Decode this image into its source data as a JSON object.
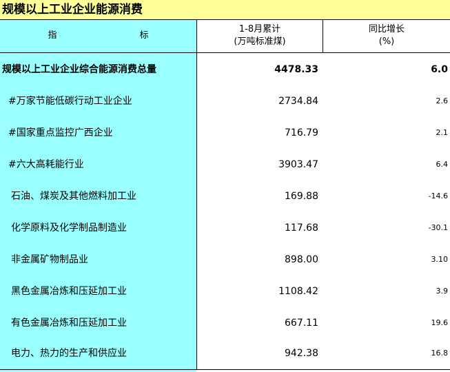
{
  "title": "规模以上工业企业能源消费",
  "header": {
    "indicator_left": "指",
    "indicator_right": "标",
    "cumulative_line1": "1-8月累计",
    "cumulative_line2": "(万吨标准煤)",
    "yoy_line1": "同比增长",
    "yoy_line2": "(%)"
  },
  "rows": [
    {
      "name": "规模以上工业企业综合能源消费总量",
      "value": "4478.33",
      "yoy": "6.0"
    },
    {
      "name": "#万家节能低碳行动工业企业",
      "value": "2734.84",
      "yoy": "2.6"
    },
    {
      "name": "#国家重点监控广西企业",
      "value": "716.79",
      "yoy": "2.1"
    },
    {
      "name": "#六大高耗能行业",
      "value": "3903.47",
      "yoy": "6.4"
    },
    {
      "name": "石油、煤炭及其他燃料加工业",
      "value": "169.88",
      "yoy": "-14.6"
    },
    {
      "name": "化学原料及化学制品制造业",
      "value": "117.68",
      "yoy": "-30.1"
    },
    {
      "name": "非金属矿物制品业",
      "value": "898.00",
      "yoy": "3.10"
    },
    {
      "name": "黑色金属冶炼和压延加工业",
      "value": "1108.42",
      "yoy": "3.9"
    },
    {
      "name": "有色金属冶炼和压延加工业",
      "value": "667.11",
      "yoy": "19.6"
    },
    {
      "name": "电力、热力的生产和供应业",
      "value": "942.38",
      "yoy": "16.8"
    }
  ]
}
